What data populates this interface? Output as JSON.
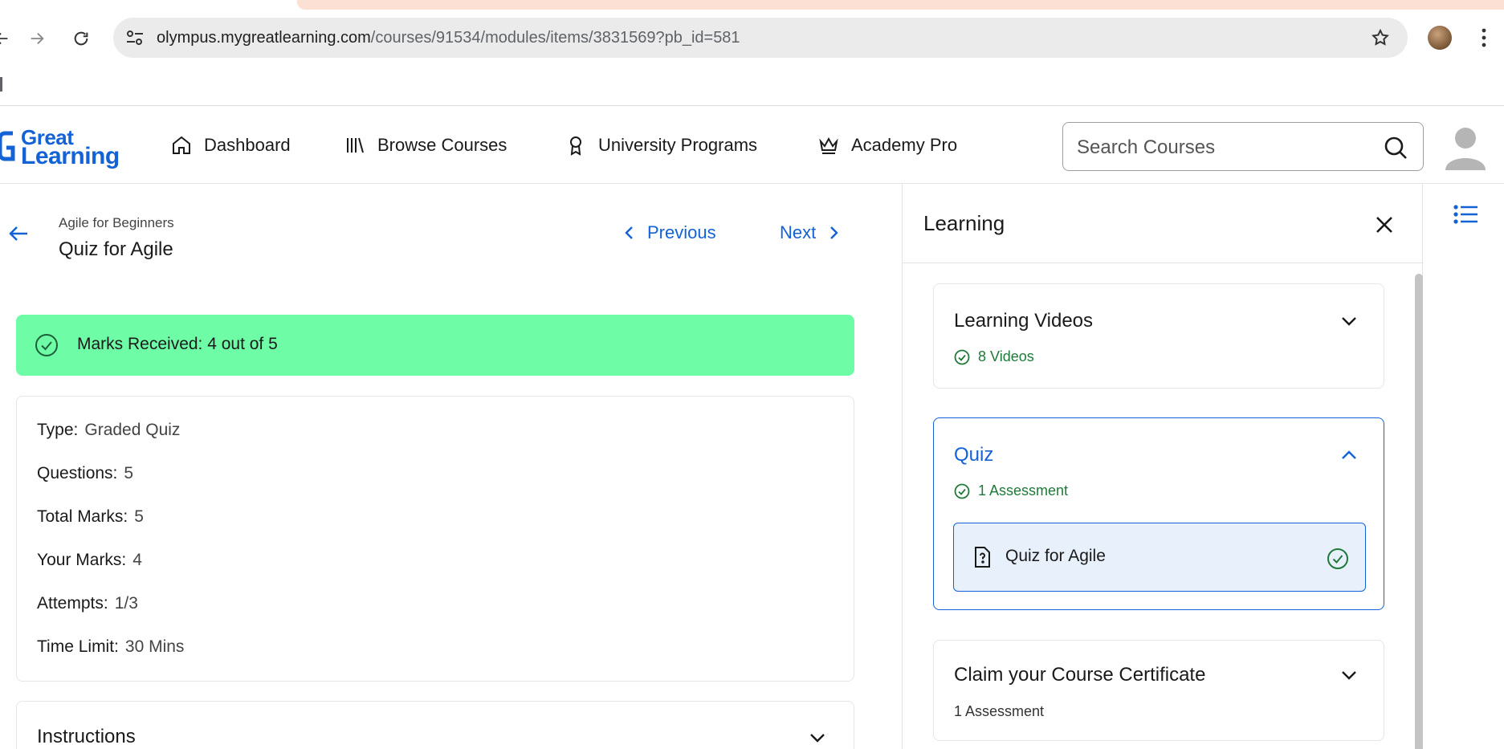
{
  "browser": {
    "url_host": "olympus.mygreatlearning.com",
    "url_path": "/courses/91534/modules/items/3831569?pb_id=581"
  },
  "header": {
    "logo_line1": "Great",
    "logo_line2": "Learning",
    "nav": [
      {
        "label": "Dashboard",
        "icon": "home-icon"
      },
      {
        "label": "Browse Courses",
        "icon": "library-icon"
      },
      {
        "label": "University Programs",
        "icon": "award-icon"
      },
      {
        "label": "Academy Pro",
        "icon": "crown-icon"
      }
    ],
    "search_placeholder": "Search Courses"
  },
  "content": {
    "breadcrumb": "Agile for Beginners",
    "title": "Quiz for Agile",
    "prev_label": "Previous",
    "next_label": "Next",
    "marks_banner": "Marks Received: 4 out of 5",
    "info": [
      {
        "key": "Type:",
        "value": "Graded Quiz"
      },
      {
        "key": "Questions:",
        "value": "5"
      },
      {
        "key": "Total Marks:",
        "value": "5"
      },
      {
        "key": "Your Marks:",
        "value": "4"
      },
      {
        "key": "Attempts:",
        "value": "1/3"
      },
      {
        "key": "Time Limit:",
        "value": "30 Mins"
      }
    ],
    "instructions_label": "Instructions"
  },
  "panel": {
    "title": "Learning",
    "modules": [
      {
        "title": "Learning Videos",
        "subtitle": "8 Videos"
      },
      {
        "title": "Quiz",
        "subtitle": "1 Assessment",
        "item": "Quiz for Agile"
      },
      {
        "title": "Claim your Course Certificate",
        "subtitle": "1 Assessment"
      }
    ]
  },
  "colors": {
    "brand_blue": "#1362d6",
    "success_banner": "#6efca6",
    "success_text": "#1f7a3a",
    "active_item_bg": "#e8f0fb"
  }
}
